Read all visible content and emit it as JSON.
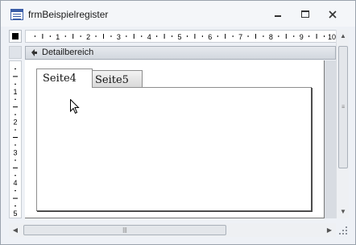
{
  "window": {
    "title": "frmBeispielregister",
    "icons": [
      "form-icon",
      "minimize-icon",
      "maximize-icon",
      "close-icon"
    ]
  },
  "ruler": {
    "horizontal_labels": [
      "1",
      "2",
      "3",
      "4",
      "5",
      "6",
      "7",
      "8",
      "9",
      "10"
    ],
    "vertical_labels": [
      "1",
      "2",
      "3",
      "4",
      "5"
    ]
  },
  "section": {
    "label": "Detailbereich"
  },
  "tab_control": {
    "tabs": [
      {
        "label": "Seite4",
        "active": true
      },
      {
        "label": "Seite5",
        "active": false
      }
    ]
  },
  "colors": {
    "window_bg": "#eef1f6",
    "section_bar": "#d2d7de",
    "canvas": "#ffffff"
  }
}
